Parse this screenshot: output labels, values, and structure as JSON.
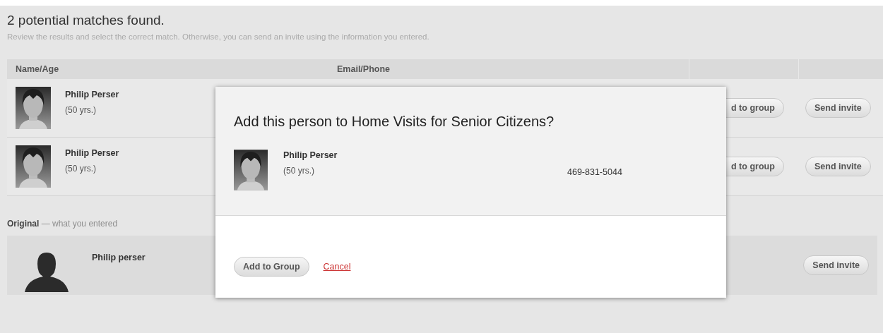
{
  "header": {
    "title": "2 potential matches found.",
    "subtitle": "Review the results and select the correct match. Otherwise, you can send an invite using the information you entered."
  },
  "table": {
    "columns": [
      "Name/Age",
      "Email/Phone"
    ],
    "rows": [
      {
        "name": "Philip Perser",
        "age": "(50 yrs.)",
        "add_button": "d to group",
        "invite_button": "Send invite"
      },
      {
        "name": "Philip Perser",
        "age": "(50 yrs.)",
        "add_button": "d to group",
        "invite_button": "Send invite"
      }
    ]
  },
  "original": {
    "label": "**Original** — what you entered",
    "name": "Philip perser",
    "invite_button": "Send invite"
  },
  "dialog": {
    "title": "Add this person to Home Visits for Senior Citizens?",
    "person": {
      "name": "Philip Perser",
      "age": "(50 yrs.)",
      "phone": "469-831-5044"
    },
    "confirm_button": "Add to Group",
    "cancel_link": "Cancel"
  }
}
